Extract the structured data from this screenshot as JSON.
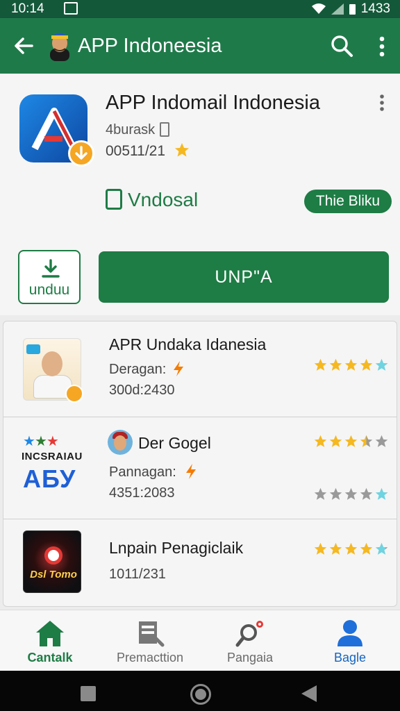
{
  "status_bar": {
    "time": "10:14",
    "battery": "1433"
  },
  "app_bar": {
    "title": "APP Indoneesia",
    "icons": [
      "back-arrow-icon",
      "avatar",
      "search-icon",
      "more-vert-icon"
    ]
  },
  "hero": {
    "app_name": "APP Indomail Indonesia",
    "developer": "4burask",
    "rating": "00511/2",
    "rating_suffix": "1",
    "dev_label": "Vndosal",
    "pill_label": "Thie Bliku",
    "download_label": "unduu",
    "primary_button": "UNP\"A"
  },
  "list": [
    {
      "title": "APR Undaka Idanesia",
      "subtitle": "Deragan:",
      "count": "300d:2430",
      "stars": [
        1,
        1,
        1,
        1,
        0.9
      ]
    },
    {
      "thumb_brand": "INCSRAIAU",
      "thumb_logo": "АБУ",
      "title": "Der Gogel",
      "subtitle": "Pannagan:",
      "count": "4351:2083",
      "stars_top": [
        1,
        1,
        1,
        0.5,
        0
      ],
      "stars_bottom": [
        0,
        0,
        0,
        0,
        0.9
      ]
    },
    {
      "thumb_text": "Dsl Tomo",
      "title": "Lnpain Penagiclaik",
      "count": "1011/231",
      "stars": [
        1,
        1,
        1,
        1,
        0.8
      ]
    }
  ],
  "bottom_nav": [
    {
      "label": "Cantalk",
      "icon": "home-icon"
    },
    {
      "label": "Premacttion",
      "icon": "form-icon"
    },
    {
      "label": "Pangaia",
      "icon": "search-notification-icon"
    },
    {
      "label": "Bagle",
      "icon": "profile-icon"
    }
  ],
  "colors": {
    "primary": "#1e7c45",
    "app_bar": "#1f7a4a",
    "status_bar": "#14583a",
    "star": "#f5b820",
    "active_blue": "#1565c0"
  }
}
